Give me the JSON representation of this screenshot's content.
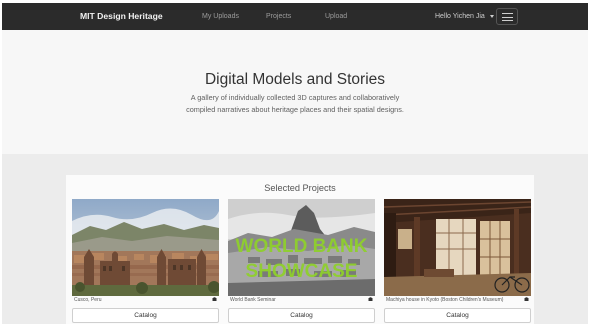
{
  "navbar": {
    "brand": "MIT Design Heritage",
    "links": [
      "My Uploads",
      "Projects",
      "Upload"
    ],
    "user": "Hello Yichen Jia",
    "colors": {
      "background": "#2b2b2b",
      "link": "#9c9c9c"
    }
  },
  "hero": {
    "title": "Digital Models and Stories",
    "subtitle_line1": "A gallery of individually collected 3D captures and collaboratively",
    "subtitle_line2": "compiled narratives about heritage places and their spatial designs."
  },
  "projects": {
    "heading": "Selected Projects",
    "cards": [
      {
        "caption": "Cusco, Peru",
        "button": "Catalog",
        "image": "cusco-city-photo",
        "icon": "model-icon"
      },
      {
        "caption": "World Bank Seminar",
        "button": "Catalog",
        "image": "machu-picchu-photo",
        "overlay": "WORLD BANK SHOWCASE",
        "icon": "model-icon"
      },
      {
        "caption": "Machiya house in Kyoto (Boston Children's Museum)",
        "button": "Catalog",
        "image": "machiya-interior-photo",
        "icon": "model-icon"
      }
    ]
  }
}
